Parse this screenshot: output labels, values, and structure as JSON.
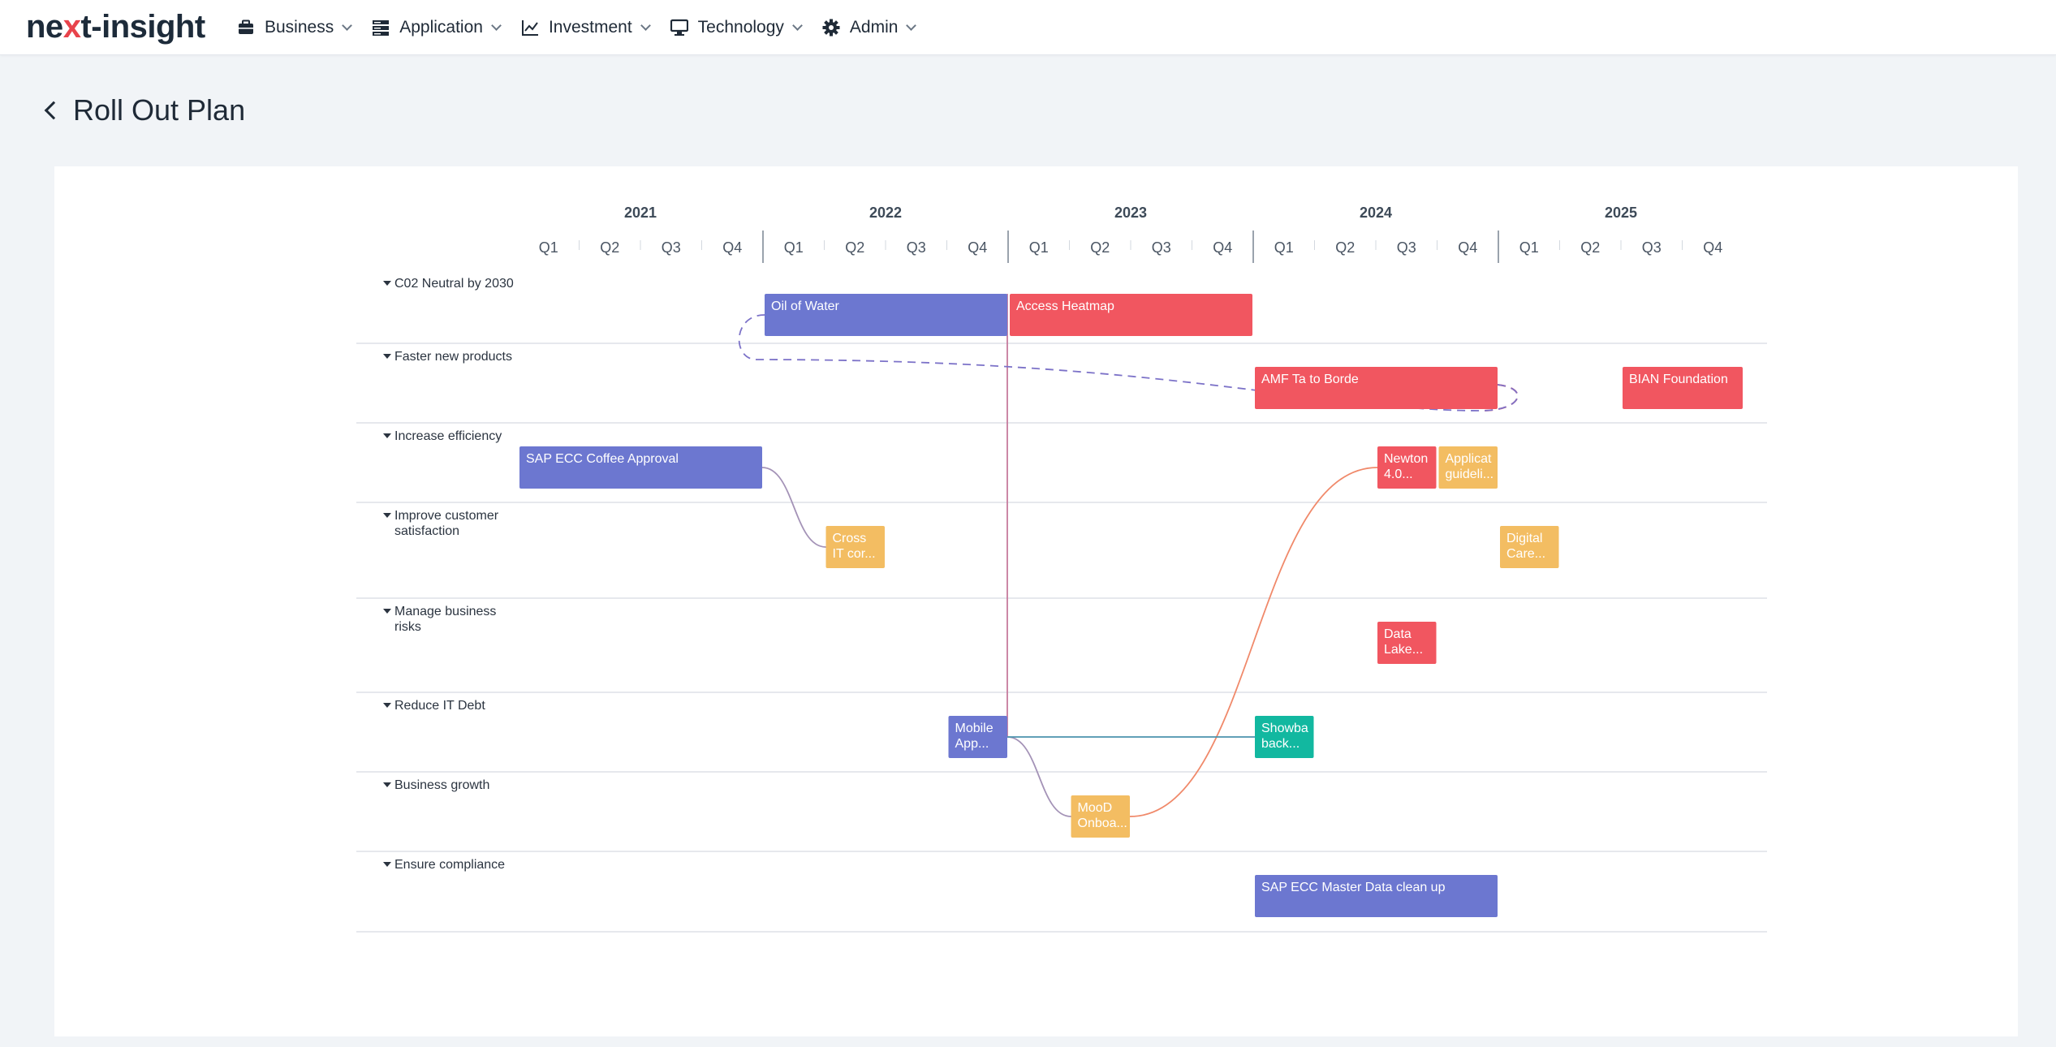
{
  "app": {
    "logo_prefix": "ne",
    "logo_x": "x",
    "logo_suffix": "t-insight"
  },
  "nav": [
    {
      "label": "Business",
      "icon": "briefcase-icon"
    },
    {
      "label": "Application",
      "icon": "server-icon"
    },
    {
      "label": "Investment",
      "icon": "line-chart-icon"
    },
    {
      "label": "Technology",
      "icon": "monitor-icon"
    },
    {
      "label": "Admin",
      "icon": "gear-icon"
    }
  ],
  "page": {
    "title": "Roll Out Plan"
  },
  "timeline": {
    "years": [
      "2021",
      "2022",
      "2023",
      "2024",
      "2025"
    ],
    "quarters": [
      "Q1",
      "Q2",
      "Q3",
      "Q4"
    ]
  },
  "lanes": [
    {
      "label_lines": [
        "C02 Neutral by 2030"
      ]
    },
    {
      "label_lines": [
        "Faster new products"
      ]
    },
    {
      "label_lines": [
        "Increase efficiency"
      ]
    },
    {
      "label_lines": [
        "Improve customer",
        "satisfaction"
      ]
    },
    {
      "label_lines": [
        "Manage business",
        "risks"
      ]
    },
    {
      "label_lines": [
        "Reduce IT Debt"
      ]
    },
    {
      "label_lines": [
        "Business growth"
      ]
    },
    {
      "label_lines": [
        "Ensure compliance"
      ]
    }
  ],
  "colors": {
    "blue": "#6c77d0",
    "red": "#f15660",
    "yellow": "#f3bd62",
    "teal": "#12b8a0"
  },
  "items": [
    {
      "id": "oil",
      "lane": 0,
      "start": 4,
      "end": 8,
      "color": "blue",
      "lines": [
        "Oil of Water"
      ]
    },
    {
      "id": "heat",
      "lane": 0,
      "start": 8,
      "end": 12,
      "color": "red",
      "lines": [
        "Access Heatmap"
      ]
    },
    {
      "id": "amf",
      "lane": 1,
      "start": 12,
      "end": 16,
      "color": "red",
      "lines": [
        "AMF Ta to Borde"
      ]
    },
    {
      "id": "bian",
      "lane": 1,
      "start": 18,
      "end": 20,
      "color": "red",
      "lines": [
        "BIAN Foundation"
      ]
    },
    {
      "id": "sap",
      "lane": 2,
      "start": 0,
      "end": 4,
      "color": "blue",
      "lines": [
        "SAP ECC Coffee Approval"
      ]
    },
    {
      "id": "newton",
      "lane": 2,
      "start": 14,
      "end": 15,
      "color": "red",
      "lines": [
        "Newton",
        "4.0..."
      ]
    },
    {
      "id": "applic",
      "lane": 2,
      "start": 15,
      "end": 16,
      "color": "yellow",
      "lines": [
        "Applicat",
        "guideli..."
      ]
    },
    {
      "id": "cross",
      "lane": 3,
      "start": 5,
      "end": 6,
      "color": "yellow",
      "lines": [
        "Cross",
        "IT cor..."
      ]
    },
    {
      "id": "digital",
      "lane": 3,
      "start": 16,
      "end": 17,
      "color": "yellow",
      "lines": [
        "Digital",
        "Care..."
      ]
    },
    {
      "id": "datalake",
      "lane": 4,
      "start": 14,
      "end": 15,
      "color": "red",
      "lines": [
        "Data",
        "Lake..."
      ]
    },
    {
      "id": "mobile",
      "lane": 5,
      "start": 7,
      "end": 8,
      "color": "blue",
      "lines": [
        "Mobile",
        "App..."
      ]
    },
    {
      "id": "showba",
      "lane": 5,
      "start": 12,
      "end": 13,
      "color": "teal",
      "lines": [
        "Showba",
        "back..."
      ]
    },
    {
      "id": "mood",
      "lane": 6,
      "start": 9,
      "end": 10,
      "color": "yellow",
      "lines": [
        "MooD",
        "Onboa..."
      ]
    },
    {
      "id": "sapmd",
      "lane": 7,
      "start": 12,
      "end": 16,
      "color": "blue",
      "lines": [
        "SAP ECC Master Data clean up"
      ]
    }
  ],
  "dependencies": [
    {
      "from": "mobile",
      "to": "heat",
      "kind": "vertical"
    },
    {
      "from": "sap",
      "to": "cross",
      "kind": "curve"
    },
    {
      "from": "mobile",
      "to": "mood",
      "kind": "curve"
    },
    {
      "from": "mood",
      "to": "newton",
      "kind": "curve"
    },
    {
      "from": "mobile",
      "to": "showba",
      "kind": "straight"
    },
    {
      "from": "amf",
      "to": "oil",
      "kind": "dashed"
    }
  ]
}
